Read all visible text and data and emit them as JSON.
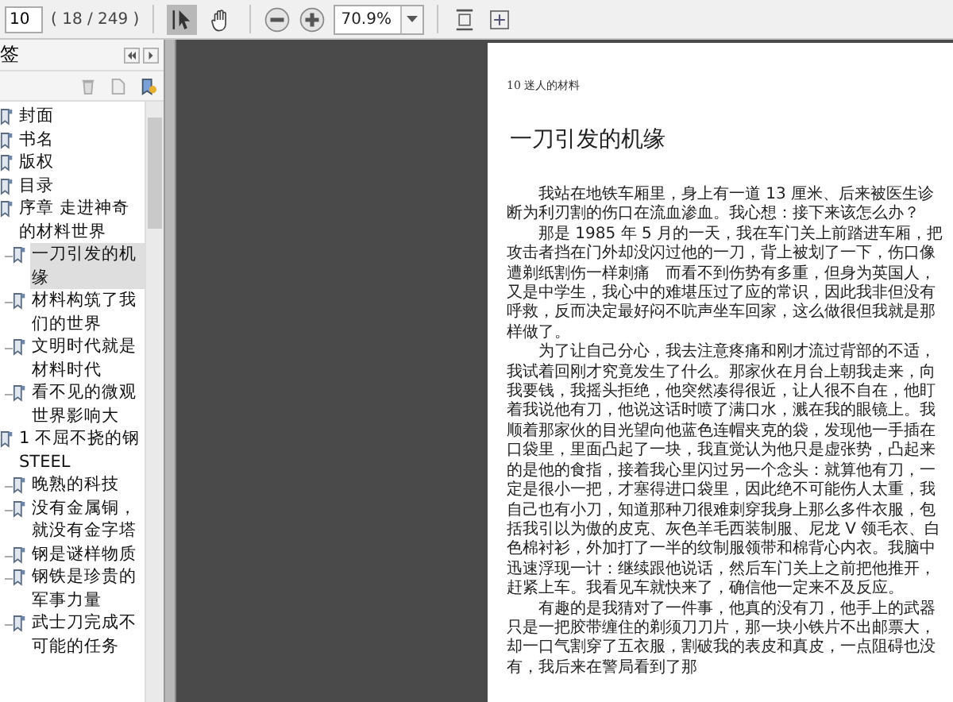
{
  "toolbar": {
    "page_number": "10",
    "page_count": "( 18 / 249 )",
    "tools": [
      {
        "kind": "select",
        "selected": true
      },
      {
        "kind": "hand",
        "selected": false
      }
    ],
    "zoom": "70.9%"
  },
  "sidebar": {
    "title": "签",
    "items": [
      {
        "label": "封面",
        "selected": false
      },
      {
        "label": "书名",
        "selected": false
      },
      {
        "label": "版权",
        "selected": false
      },
      {
        "label": "目录",
        "selected": false
      },
      {
        "label": "序章 走进神奇的材料世界",
        "selected": false,
        "children": [
          {
            "label": "一刀引发的机缘",
            "selected": true
          },
          {
            "label": "材料构筑了我们的世界",
            "selected": false
          },
          {
            "label": "文明时代就是材料时代",
            "selected": false
          },
          {
            "label": "看不见的微观世界影响大",
            "selected": false
          }
        ]
      },
      {
        "label": "1 不屈不挠的钢STEEL",
        "selected": false,
        "children": [
          {
            "label": "晚熟的科技",
            "selected": false
          },
          {
            "label": "没有金属铜，就没有金字塔",
            "selected": false
          },
          {
            "label": "钢是谜样物质",
            "selected": false
          },
          {
            "label": "钢铁是珍贵的军事力量",
            "selected": false
          },
          {
            "label": "武士刀完成不可能的任务",
            "selected": false
          }
        ]
      }
    ]
  },
  "document": {
    "running_head": "10 迷人的材料",
    "heading": "一刀引发的机缘",
    "paragraphs": [
      "我站在地铁车厢里，身上有一道 13 厘米、后来被医生诊断为利刃割的伤口在流血渗血。我心想：接下来该怎么办？",
      "那是 1985 年 5 月的一天，我在车门关上前踏进车厢，把攻击者挡在门外却没闪过他的一刀，背上被划了一下，伤口像遭剃纸割伤一样刺痛　而看不到伤势有多重，但身为英国人，又是中学生，我心中的难堪压过了应的常识，因此我非但没有呼救，反而决定最好闷不吭声坐车回家，这么做很但我就是那样做了。",
      "为了让自己分心，我去注意疼痛和刚才流过背部的不适，我试着回刚才究竟发生了什么。那家伙在月台上朝我走来，向我要钱，我摇头拒绝，他突然凑得很近，让人很不自在，他盯着我说他有刀，他说这话时喷了满口水，溅在我的眼镜上。我顺着那家伙的目光望向他蓝色连帽夹克的袋，发现他一手插在口袋里，里面凸起了一块，我直觉认为他只是虚张势，凸起来的是他的食指，接着我心里闪过另一个念头：就算他有刀，一定是很小一把，才塞得进口袋里，因此绝不可能伤人太重，我自己也有小刀，知道那种刀很难刺穿我身上那么多件衣服，包括我引以为傲的皮克、灰色羊毛西装制服、尼龙 V 领毛衣、白色棉衬衫，外加打了一半的纹制服领带和棉背心内衣。我脑中迅速浮现一计：继续跟他说话，然后车门关上之前把他推开，赶紧上车。我看见车就快来了，确信他一定来不及反应。",
      "有趣的是我猜对了一件事，他真的没有刀，他手上的武器只是一把胶带缠住的剃须刀刀片，那一块小铁片不出邮票大，却一口气割穿了五衣服，割破我的表皮和真皮，一点阻碍也没有，我后来在警局看到了那"
    ]
  }
}
